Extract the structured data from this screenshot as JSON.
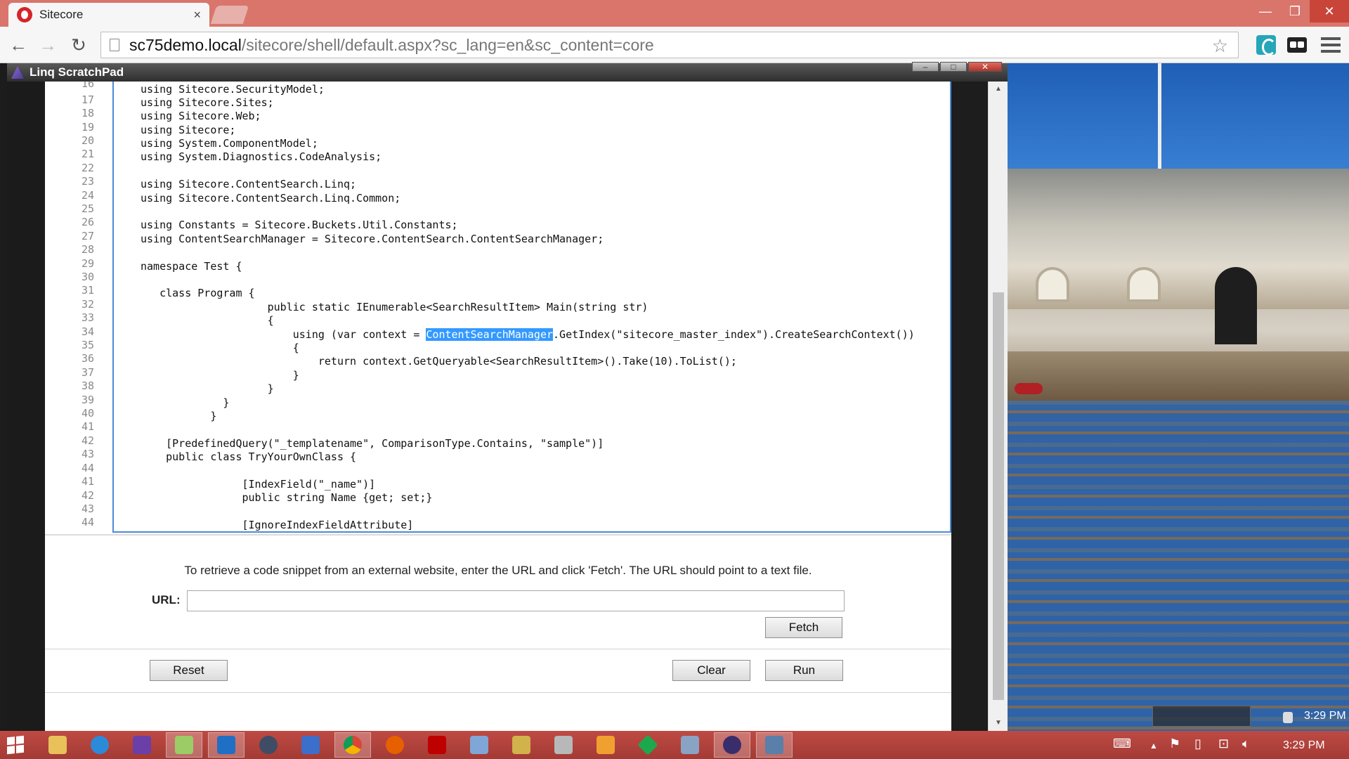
{
  "browser": {
    "tab_title": "Sitecore",
    "tab_close": "×",
    "url_host": "sc75demo.local",
    "url_path": "/sitecore/shell/default.aspx?sc_lang=en&sc_content=core",
    "back": "←",
    "forward": "→",
    "reload": "↻",
    "star": "☆",
    "win_min": "—",
    "win_max": "❐",
    "win_close": "✕"
  },
  "dialog": {
    "title": "Linq ScratchPad",
    "min": "–",
    "max": "□",
    "close": "✕"
  },
  "editor": {
    "lines": [
      {
        "no": "16",
        "text": ""
      },
      {
        "no": "17",
        "text": "using Sitecore.Sites;"
      },
      {
        "no": "18",
        "text": "using Sitecore.Web;"
      },
      {
        "no": "19",
        "text": "using Sitecore;"
      },
      {
        "no": "20",
        "text": "using System.ComponentModel;"
      },
      {
        "no": "21",
        "text": "using System.Diagnostics.CodeAnalysis;"
      },
      {
        "no": "22",
        "text": ""
      },
      {
        "no": "23",
        "text": "using Sitecore.ContentSearch.Linq;"
      },
      {
        "no": "24",
        "text": "using Sitecore.ContentSearch.Linq.Common;"
      },
      {
        "no": "25",
        "text": ""
      },
      {
        "no": "26",
        "text": "using Constants = Sitecore.Buckets.Util.Constants;"
      },
      {
        "no": "27",
        "text": "using ContentSearchManager = Sitecore.ContentSearch.ContentSearchManager;"
      },
      {
        "no": "28",
        "text": ""
      },
      {
        "no": "29",
        "text": "namespace Test {"
      },
      {
        "no": "30",
        "text": ""
      },
      {
        "no": "31",
        "text": "   class Program {"
      },
      {
        "no": "32",
        "text": "                    public static IEnumerable<SearchResultItem> Main(string str)"
      },
      {
        "no": "33",
        "text": "                    {"
      },
      {
        "no": "34",
        "text": "                        using (var context = ContentSearchManager.GetIndex(\"sitecore_master_index\").CreateSearchContext())"
      },
      {
        "no": "35",
        "text": "                        {"
      },
      {
        "no": "36",
        "text": "                            return context.GetQueryable<SearchResultItem>().Take(10).ToList();"
      },
      {
        "no": "37",
        "text": "                        }"
      },
      {
        "no": "38",
        "text": "                    }"
      },
      {
        "no": "39",
        "text": "             }"
      },
      {
        "no": "40",
        "text": "           }"
      },
      {
        "no": "41",
        "text": ""
      },
      {
        "no": "42",
        "text": "    [PredefinedQuery(\"_templatename\", ComparisonType.Contains, \"sample\")]"
      },
      {
        "no": "43",
        "text": "    public class TryYourOwnClass {"
      },
      {
        "no": "44",
        "text": ""
      }
    ],
    "first_line": "using Sitecore.SecurityModel;"
  },
  "fetch": {
    "info": "To retrieve a code snippet from an external website, enter the URL and click 'Fetch'. The URL should point to a text file.",
    "url_label": "URL:",
    "url_value": "",
    "fetch_label": "Fetch"
  },
  "actions": {
    "reset_label": "Reset",
    "clear_label": "Clear",
    "run_label": "Run"
  },
  "system": {
    "clock_desktop": "3:29 PM",
    "clock_taskbar": "3:29 PM"
  },
  "taskbar_icons": [
    "start-icon",
    "file-explorer-icon",
    "internet-explorer-icon",
    "visual-studio-icon",
    "notepad-icon",
    "outlook-icon",
    "ie-downloads-icon",
    "remote-desktop-icon",
    "chrome-icon",
    "firefox-icon",
    "filezilla-icon",
    "network-icon",
    "setup-icon",
    "tools-icon",
    "paint-icon",
    "git-icon",
    "database-icon",
    "obs-icon",
    "task-manager-icon"
  ],
  "colors": {
    "titlebar": "#d9756b",
    "taskbar": "#b3443e",
    "selection": "#3399ff",
    "editor_border": "#4d8ad6"
  }
}
